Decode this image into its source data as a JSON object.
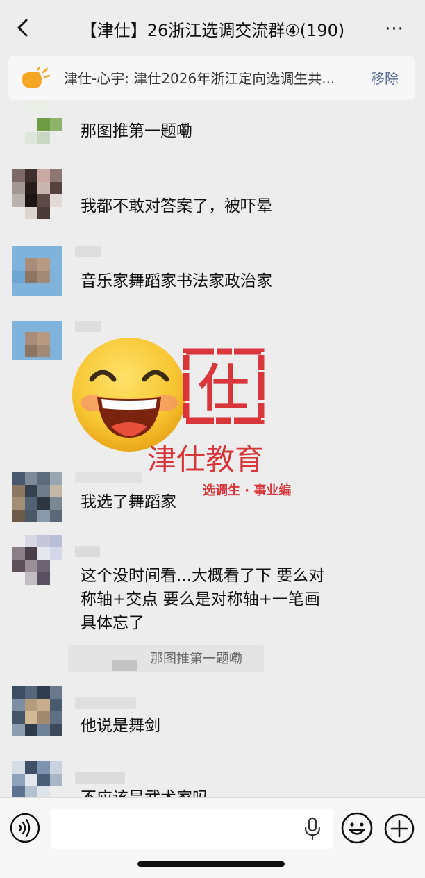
{
  "header": {
    "title": "【津仕】26浙江选调交流群④(190)",
    "more": "···"
  },
  "pinned": {
    "text": "津仕-心宇: 津仕2026年浙江定向选调生共...",
    "remove": "移除"
  },
  "messages": [
    {
      "text": "那图推第一题嘞"
    },
    {
      "text": "我都不敢对答案了，被吓晕"
    },
    {
      "text": "音乐家舞蹈家书法家政治家"
    },
    {
      "text": "我选了舞蹈家"
    },
    {
      "lines": [
        "这个没时间看...大概看了下 要么对",
        "称轴+交点 要么是对称轴+一笔画",
        "具体忘了"
      ],
      "quote": "那图推第一题嘞"
    },
    {
      "text": "他说是舞剑"
    },
    {
      "text": "不应该是武术家吗"
    }
  ],
  "sticker": {
    "stamp_char": "仕",
    "watermark": "津仕教育",
    "watermark_sub": "选调生 · 事业编"
  },
  "icons": {
    "back": "chevron-left-icon",
    "more": "ellipsis-icon",
    "pin": "megaphone-icon",
    "voice": "voice-icon",
    "mic": "mic-icon",
    "emoji": "smiley-icon",
    "add": "plus-icon"
  },
  "colors": {
    "accent_link": "#576b95",
    "background": "#ededed",
    "watermark_red": "#d8363a"
  }
}
